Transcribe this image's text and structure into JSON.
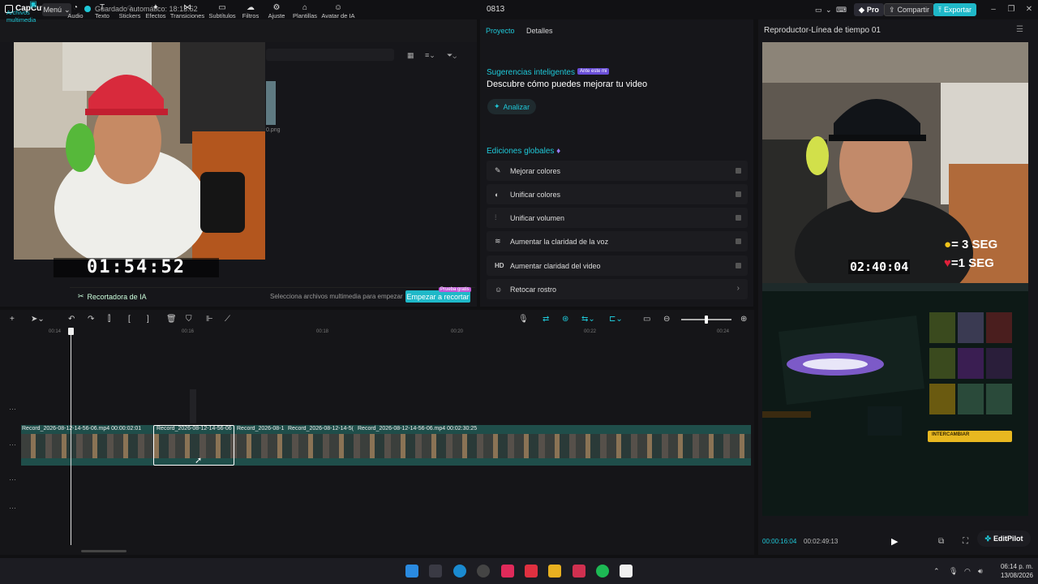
{
  "titlebar": {
    "app_name": "CapCut",
    "menu_label": "Menú",
    "autosave": "Guardado automático: 18:13:52",
    "project_name": "0813",
    "pro_label": "Pro",
    "share_label": "Compartir",
    "export_label": "Exportar"
  },
  "toolbar": {
    "items": [
      {
        "label": "Archivos multimedia",
        "icon": "media-icon",
        "active": true
      },
      {
        "label": "Audio",
        "icon": "audio-icon"
      },
      {
        "label": "Texto",
        "icon": "text-icon"
      },
      {
        "label": "Stickers",
        "icon": "sticker-icon"
      },
      {
        "label": "Efectos",
        "icon": "effects-icon"
      },
      {
        "label": "Transiciones",
        "icon": "transition-icon"
      },
      {
        "label": "Subtítulos",
        "icon": "subtitles-icon"
      },
      {
        "label": "Filtros",
        "icon": "filter-icon"
      },
      {
        "label": "Ajuste",
        "icon": "adjust-icon"
      },
      {
        "label": "Plantillas",
        "icon": "template-icon"
      },
      {
        "label": "Avatar de IA",
        "icon": "avatar-icon"
      }
    ]
  },
  "media": {
    "webcam_timer": "01:54:52",
    "thumb_name": "0.png",
    "cutter_label": "Recortadora de IA",
    "cutter_hint": "Selecciona archivos multimedia para empezar",
    "cutter_button": "Empezar a recortar",
    "free_badge": "Prueba gratis"
  },
  "props": {
    "tabs": [
      "Proyecto",
      "Detalles"
    ],
    "smart_title": "Sugerencias inteligentes",
    "smart_badge": "Ante este mi",
    "smart_sub": "Descubre cómo puedes mejorar tu video",
    "analyze_label": "Analizar",
    "global_title": "Ediciones globales",
    "edits": [
      {
        "label": "Mejorar colores",
        "icon": "wand-icon"
      },
      {
        "label": "Unificar colores",
        "icon": "palette-icon"
      },
      {
        "label": "Unificar volumen",
        "icon": "volume-sliders-icon"
      },
      {
        "label": "Aumentar la claridad de la voz",
        "icon": "waveform-icon"
      },
      {
        "label": "Aumentar claridad del video",
        "icon": "hd-icon"
      },
      {
        "label": "Retocar rostro",
        "icon": "face-icon"
      }
    ]
  },
  "player": {
    "title": "Reproductor-Línea de tiempo 01",
    "cam_timer": "02:40:04",
    "seg1": "= 3 SEG",
    "seg2": "=1 SEG",
    "exchange_label": "INTERCAMBIAR",
    "time_current": "00:00:16:04",
    "time_total": "00:02:49:13",
    "editpilot": "EditPilot"
  },
  "timeline": {
    "ruler": [
      "00:14",
      "00:16",
      "00:18",
      "00:20",
      "00:22",
      "00:24"
    ],
    "clips": [
      {
        "label": "Record_2026-08-12-14-56-06.mp4   00:00:02:01"
      },
      {
        "label": "Record_2026-08-12-14-56-06"
      },
      {
        "label": "Record_2026-08-1"
      },
      {
        "label": "Record_2026-08-12-14-5("
      },
      {
        "label": "Record_2026-08-12-14-56-06.mp4   00:02:30:25"
      }
    ]
  },
  "taskbar": {
    "time": "06:14 p. m.",
    "date": "13/08/2026"
  },
  "colors": {
    "accent": "#1fc8d8",
    "background": "#101012",
    "panel": "#16161a",
    "track": "#1f4e4a"
  }
}
